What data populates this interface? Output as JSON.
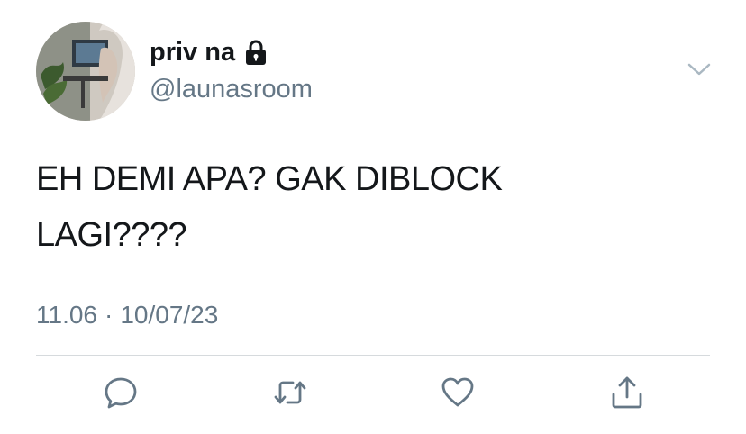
{
  "tweet": {
    "display_name": "priv na",
    "handle": "@launasroom",
    "text_line1": "EH DEMI APA? GAK DIBLOCK",
    "text_line2": "LAGI????",
    "time": "11.06",
    "separator": "·",
    "date": "10/07/23"
  },
  "icons": {
    "lock": "lock-icon",
    "menu": "chevron-down-icon",
    "reply": "comment-icon",
    "retweet": "retweet-icon",
    "like": "heart-icon",
    "share": "share-icon"
  },
  "colors": {
    "text": "#14171a",
    "secondary": "#657786",
    "divider": "#d6dadd"
  }
}
